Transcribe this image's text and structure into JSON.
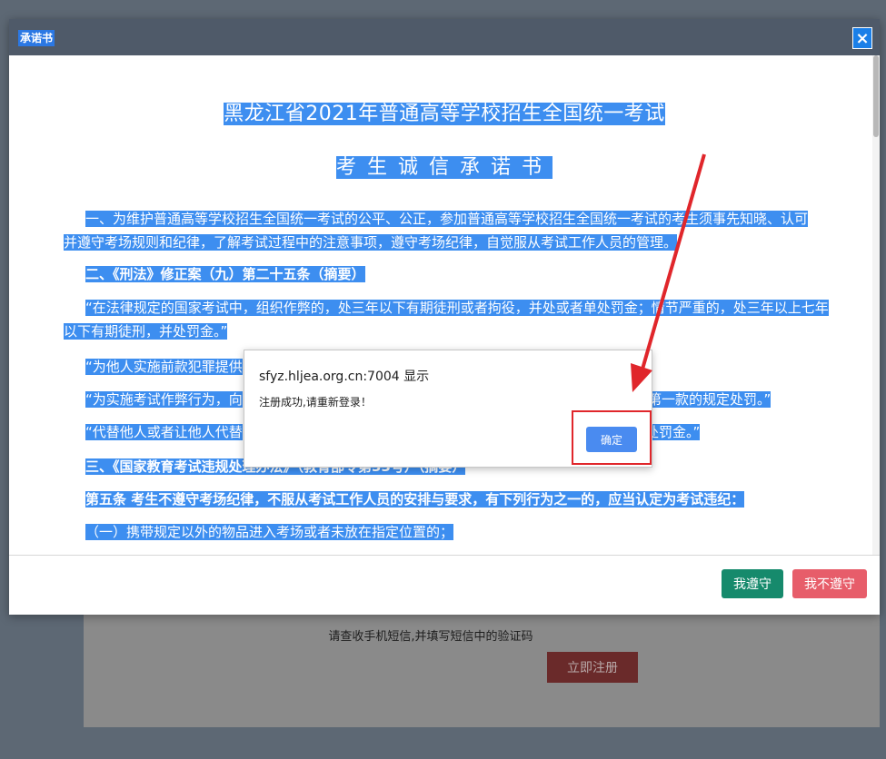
{
  "background": {
    "hint": "请查收手机短信,并填写短信中的验证码",
    "register_button": "立即注册"
  },
  "modal": {
    "title": "承诺书",
    "close_icon": "close-icon",
    "heading1": "黑龙江省2021年普通高等学校招生全国统一考试",
    "heading2": "考生诚信承诺书",
    "paragraphs": [
      "一、为维护普通高等学校招生全国统一考试的公平、公正，参加普通高等学校招生全国统一考试的考生须事先知晓、认可并遵守考场规则和纪律，了解考试过程中的注意事项，遵守考场纪律，自觉服从考试工作人员的管理。",
      "二、《刑法》修正案（九）第二十五条（摘要）",
      "“在法律规定的国家考试中，组织作弊的，处三年以下有期徒刑或者拘役，并处或者单处罚金；情节严重的，处三年以上七年以下有期徒刑，并处罚金。”",
      "“为他人实施前款犯罪提供",
      "“为实施考试作弊行为，向",
      "照第一款的规定处罚。”",
      "“代替他人或者让他人代替",
      "处罚金。”",
      "三、《国家教育考试违规处理办法》（教育部令第33号）（摘要）",
      "第五条 考生不遵守考场纪律，不服从考试工作人员的安排与要求，有下列行为之一的，应当认定为考试违纪：",
      "（一）携带规定以外的物品进入考场或者未放在指定位置的；"
    ],
    "agree_button": "我遵守",
    "disagree_button": "我不遵守"
  },
  "alert": {
    "origin": "sfyz.hljea.org.cn:7004 显示",
    "message": "注册成功,请重新登录！",
    "ok_button": "确定"
  },
  "colors": {
    "selection": "#3d8ef0",
    "header": "#4f5a69",
    "agree": "#168a6c",
    "disagree": "#e75d6a",
    "annotation": "#e0262b"
  }
}
